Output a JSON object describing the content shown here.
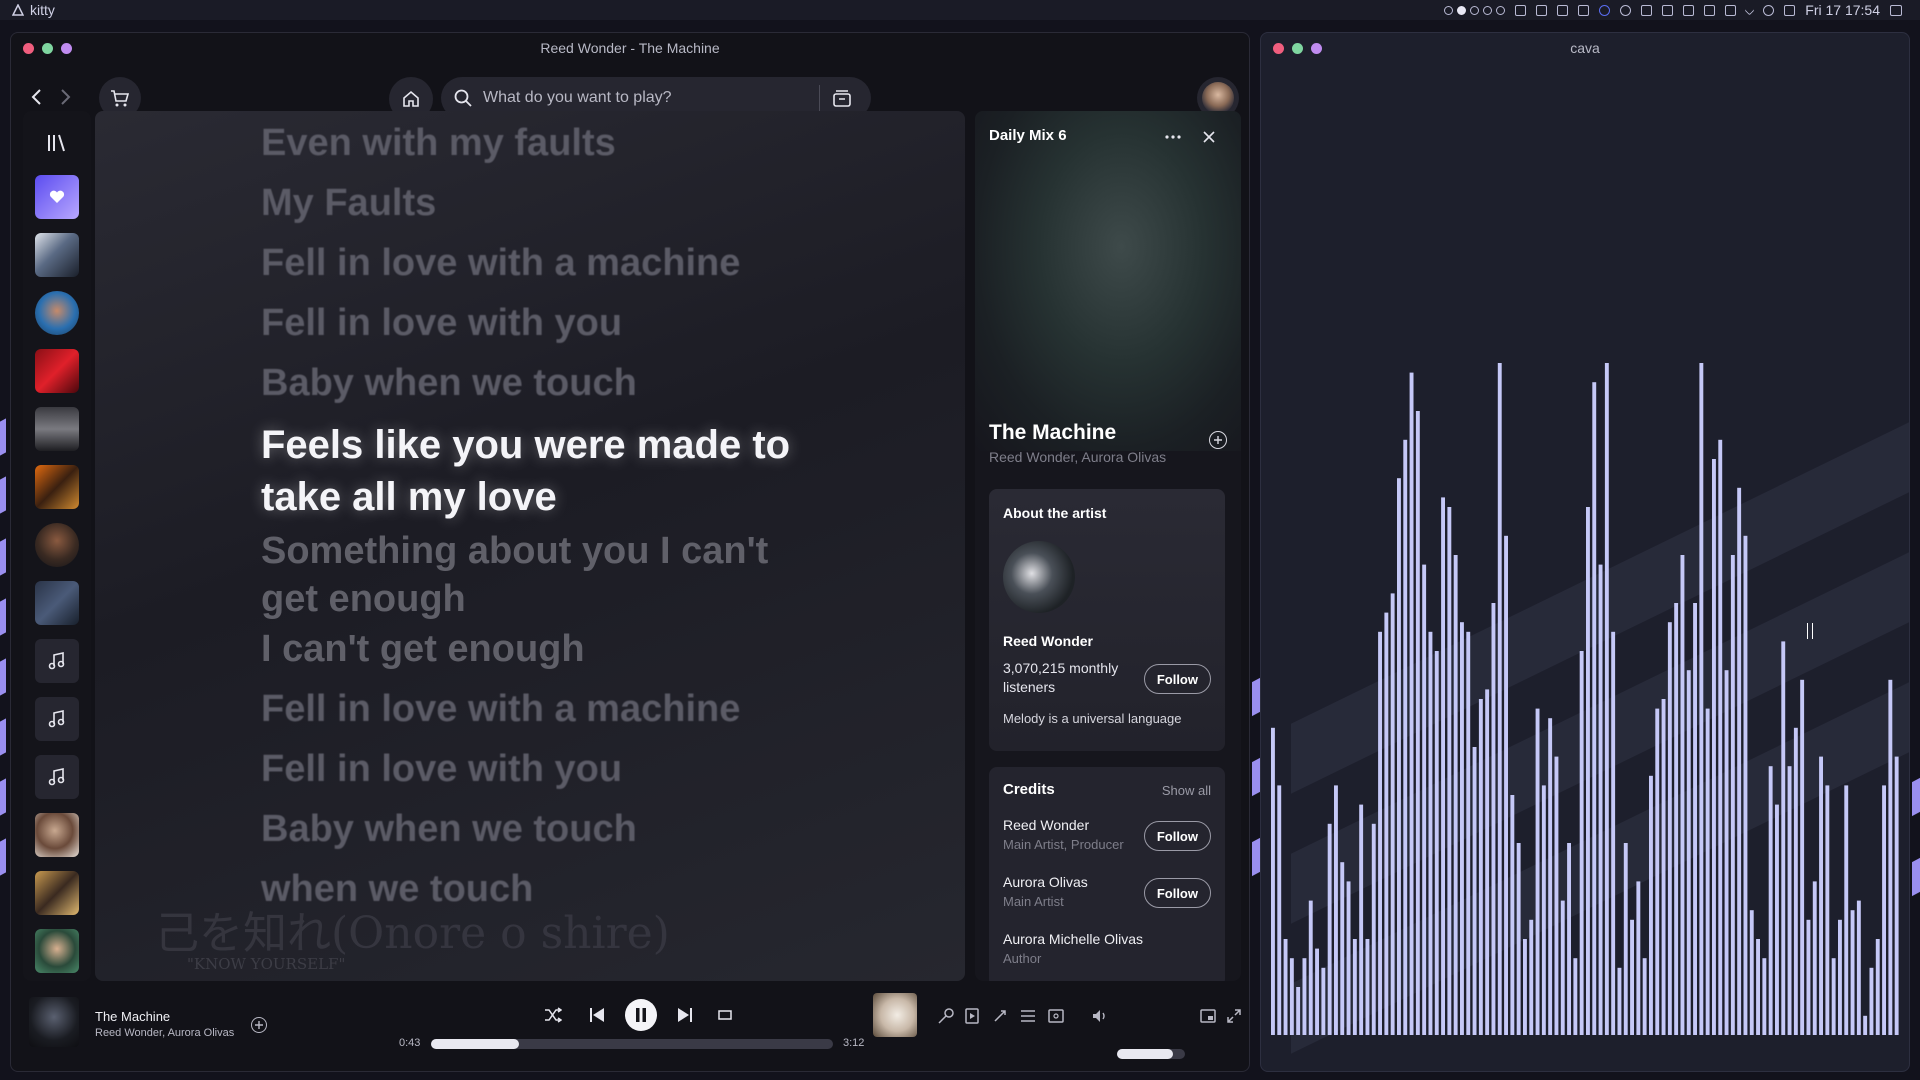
{
  "system_bar": {
    "app_name": "kitty",
    "workspaces": [
      false,
      true,
      false,
      false,
      false
    ],
    "clock": "Fri 17 17:54"
  },
  "spotify_window": {
    "title": "Reed Wonder - The Machine",
    "search": {
      "placeholder": "What do you want to play?"
    }
  },
  "lyrics": {
    "lines": [
      {
        "text": "Even with my faults",
        "state": "past"
      },
      {
        "text": "My Faults",
        "state": "past"
      },
      {
        "text": "Fell in love with a machine",
        "state": "past"
      },
      {
        "text": "Fell in love with you",
        "state": "past"
      },
      {
        "text": "Baby when we touch",
        "state": "past"
      },
      {
        "text": "Feels like you were made to take all my love",
        "state": "active"
      },
      {
        "text": "Something about you I can't get enough",
        "state": "next"
      },
      {
        "text": "I can't get enough",
        "state": "next"
      },
      {
        "text": "Fell in love with a machine",
        "state": "next"
      },
      {
        "text": "Fell in love with you",
        "state": "next"
      },
      {
        "text": "Baby when we touch",
        "state": "next"
      },
      {
        "text": "when we touch",
        "state": "next"
      }
    ],
    "background_text_1": "己を知れ(Onore o shire)",
    "background_text_2": "\"KNOW YOURSELF\""
  },
  "now_playing_panel": {
    "playlist_name": "Daily Mix 6",
    "track_title": "The Machine",
    "track_artists": "Reed Wonder, Aurora Olivas",
    "about": {
      "heading": "About the artist",
      "artist_name": "Reed Wonder",
      "listeners": "3,070,215 monthly listeners",
      "bio": "Melody is a universal language",
      "follow_label": "Follow"
    },
    "credits": {
      "heading": "Credits",
      "show_all": "Show all",
      "people": [
        {
          "name": "Reed Wonder",
          "role": "Main Artist, Producer",
          "follow": "Follow"
        },
        {
          "name": "Aurora Olivas",
          "role": "Main Artist",
          "follow": "Follow"
        },
        {
          "name": "Aurora Michelle Olivas",
          "role": "Author",
          "follow": ""
        }
      ]
    }
  },
  "player": {
    "track_title": "The Machine",
    "track_artists": "Reed Wonder, Aurora Olivas",
    "elapsed": "0:43",
    "duration": "3:12",
    "progress_fraction": 0.22,
    "volume_fraction": 0.82,
    "is_playing": true
  },
  "cava_window": {
    "title": "cava",
    "bars": [
      0.32,
      0.26,
      0.1,
      0.08,
      0.05,
      0.08,
      0.14,
      0.09,
      0.07,
      0.22,
      0.26,
      0.18,
      0.16,
      0.1,
      0.24,
      0.1,
      0.22,
      0.42,
      0.44,
      0.46,
      0.58,
      0.62,
      0.69,
      0.65,
      0.49,
      0.42,
      0.4,
      0.56,
      0.55,
      0.5,
      0.43,
      0.42,
      0.3,
      0.35,
      0.36,
      0.45,
      0.7,
      0.52,
      0.25,
      0.2,
      0.1,
      0.12,
      0.34,
      0.26,
      0.33,
      0.29,
      0.14,
      0.2,
      0.08,
      0.4,
      0.55,
      0.68,
      0.49,
      0.7,
      0.42,
      0.07,
      0.2,
      0.12,
      0.16,
      0.08,
      0.27,
      0.34,
      0.35,
      0.43,
      0.45,
      0.5,
      0.38,
      0.45,
      0.7,
      0.34,
      0.6,
      0.62,
      0.38,
      0.5,
      0.57,
      0.52,
      0.13,
      0.1,
      0.08,
      0.28,
      0.24,
      0.41,
      0.28,
      0.32,
      0.37,
      0.12,
      0.16,
      0.29,
      0.26,
      0.08,
      0.12,
      0.26,
      0.13,
      0.14,
      0.02,
      0.07,
      0.1,
      0.26,
      0.37,
      0.29
    ],
    "bar_color": "#c5c8f7"
  },
  "colors": {
    "window_bg": "#121218",
    "cava_bg": "#1d1f2c",
    "accent_purple": "#9a8ff0",
    "liked_songs": "#7c6cf0"
  }
}
